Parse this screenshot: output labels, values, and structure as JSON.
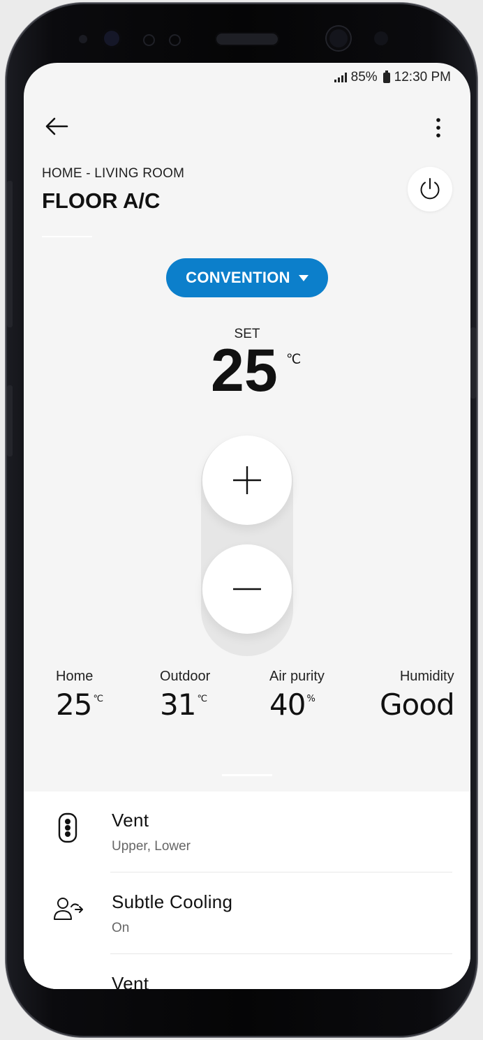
{
  "status_bar": {
    "battery": "85%",
    "time": "12:30 PM"
  },
  "header": {
    "location": "HOME - LIVING ROOM",
    "device_name": "FLOOR A/C"
  },
  "mode": {
    "label": "CONVENTION"
  },
  "setpoint": {
    "label": "SET",
    "value": "25",
    "unit": "℃"
  },
  "stats": [
    {
      "label": "Home",
      "value": "25",
      "unit": "℃"
    },
    {
      "label": "Outdoor",
      "value": "31",
      "unit": "℃"
    },
    {
      "label": "Air purity",
      "value": "40",
      "unit": "%"
    },
    {
      "label": "Humidity",
      "value": "Good",
      "unit": ""
    }
  ],
  "settings": [
    {
      "title": "Vent",
      "subtitle": "Upper, Lower",
      "icon": "vent-icon"
    },
    {
      "title": "Subtle Cooling",
      "subtitle": "On",
      "icon": "subtle-cooling-icon"
    },
    {
      "title": "Vent",
      "subtitle": "",
      "icon": ""
    }
  ],
  "colors": {
    "accent": "#0c7fcb",
    "background": "#f5f5f5"
  }
}
